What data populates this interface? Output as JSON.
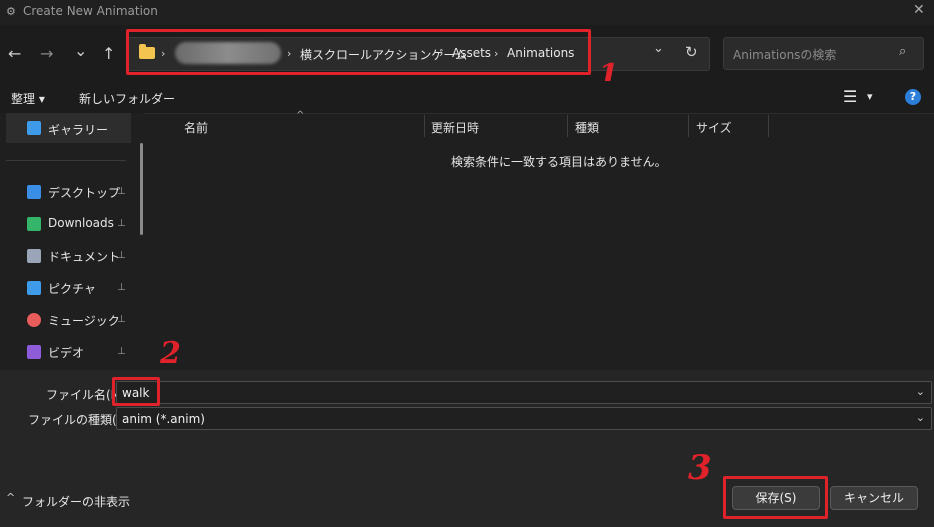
{
  "window": {
    "title": "Create New Animation",
    "close_glyph": "✕",
    "app_glyph": "⚙"
  },
  "nav": {
    "back": "←",
    "forward": "→",
    "recent": "⌄",
    "up": "↑",
    "breadcrumb": [
      "横スクロールアクションゲーム",
      "Assets",
      "Animations"
    ],
    "sep": "›",
    "dropdown": "⌄",
    "refresh": "↻",
    "search_placeholder": "Animationsの検索",
    "search_glyph": "⌕"
  },
  "toolbar": {
    "organize": "整理 ▾",
    "new_folder": "新しいフォルダー",
    "view_glyph": "☰",
    "view_dropdown": "▾",
    "help": "?"
  },
  "sidebar": {
    "gallery": "ギャラリー",
    "pin": "📌",
    "items": [
      {
        "label": "デスクトップ",
        "icon": "desktop-icon",
        "color": "#3a8ee6"
      },
      {
        "label": "Downloads",
        "icon": "downloads-icon",
        "color": "#35b56a"
      },
      {
        "label": "ドキュメント",
        "icon": "documents-icon",
        "color": "#9aa6b8"
      },
      {
        "label": "ピクチャ",
        "icon": "pictures-icon",
        "color": "#3d9be9"
      },
      {
        "label": "ミュージック",
        "icon": "music-icon",
        "color": "#e85c5c"
      },
      {
        "label": "ビデオ",
        "icon": "videos-icon",
        "color": "#8e5cd9"
      }
    ]
  },
  "columns": {
    "sort_indicator": "^",
    "name": "名前",
    "date": "更新日時",
    "type": "種類",
    "size": "サイズ"
  },
  "empty_message": "検索条件に一致する項目はありません。",
  "form": {
    "filename_label": "ファイル名(N):",
    "filename_value": "walk",
    "filetype_label": "ファイルの種類(T):",
    "filetype_value": "anim (*.anim)",
    "chevron": "⌄"
  },
  "footer": {
    "hide_folders": "フォルダーの非表示",
    "hide_glyph": "^",
    "save": "保存(S)",
    "cancel": "キャンセル"
  },
  "annotations": [
    "1",
    "2",
    "3"
  ]
}
